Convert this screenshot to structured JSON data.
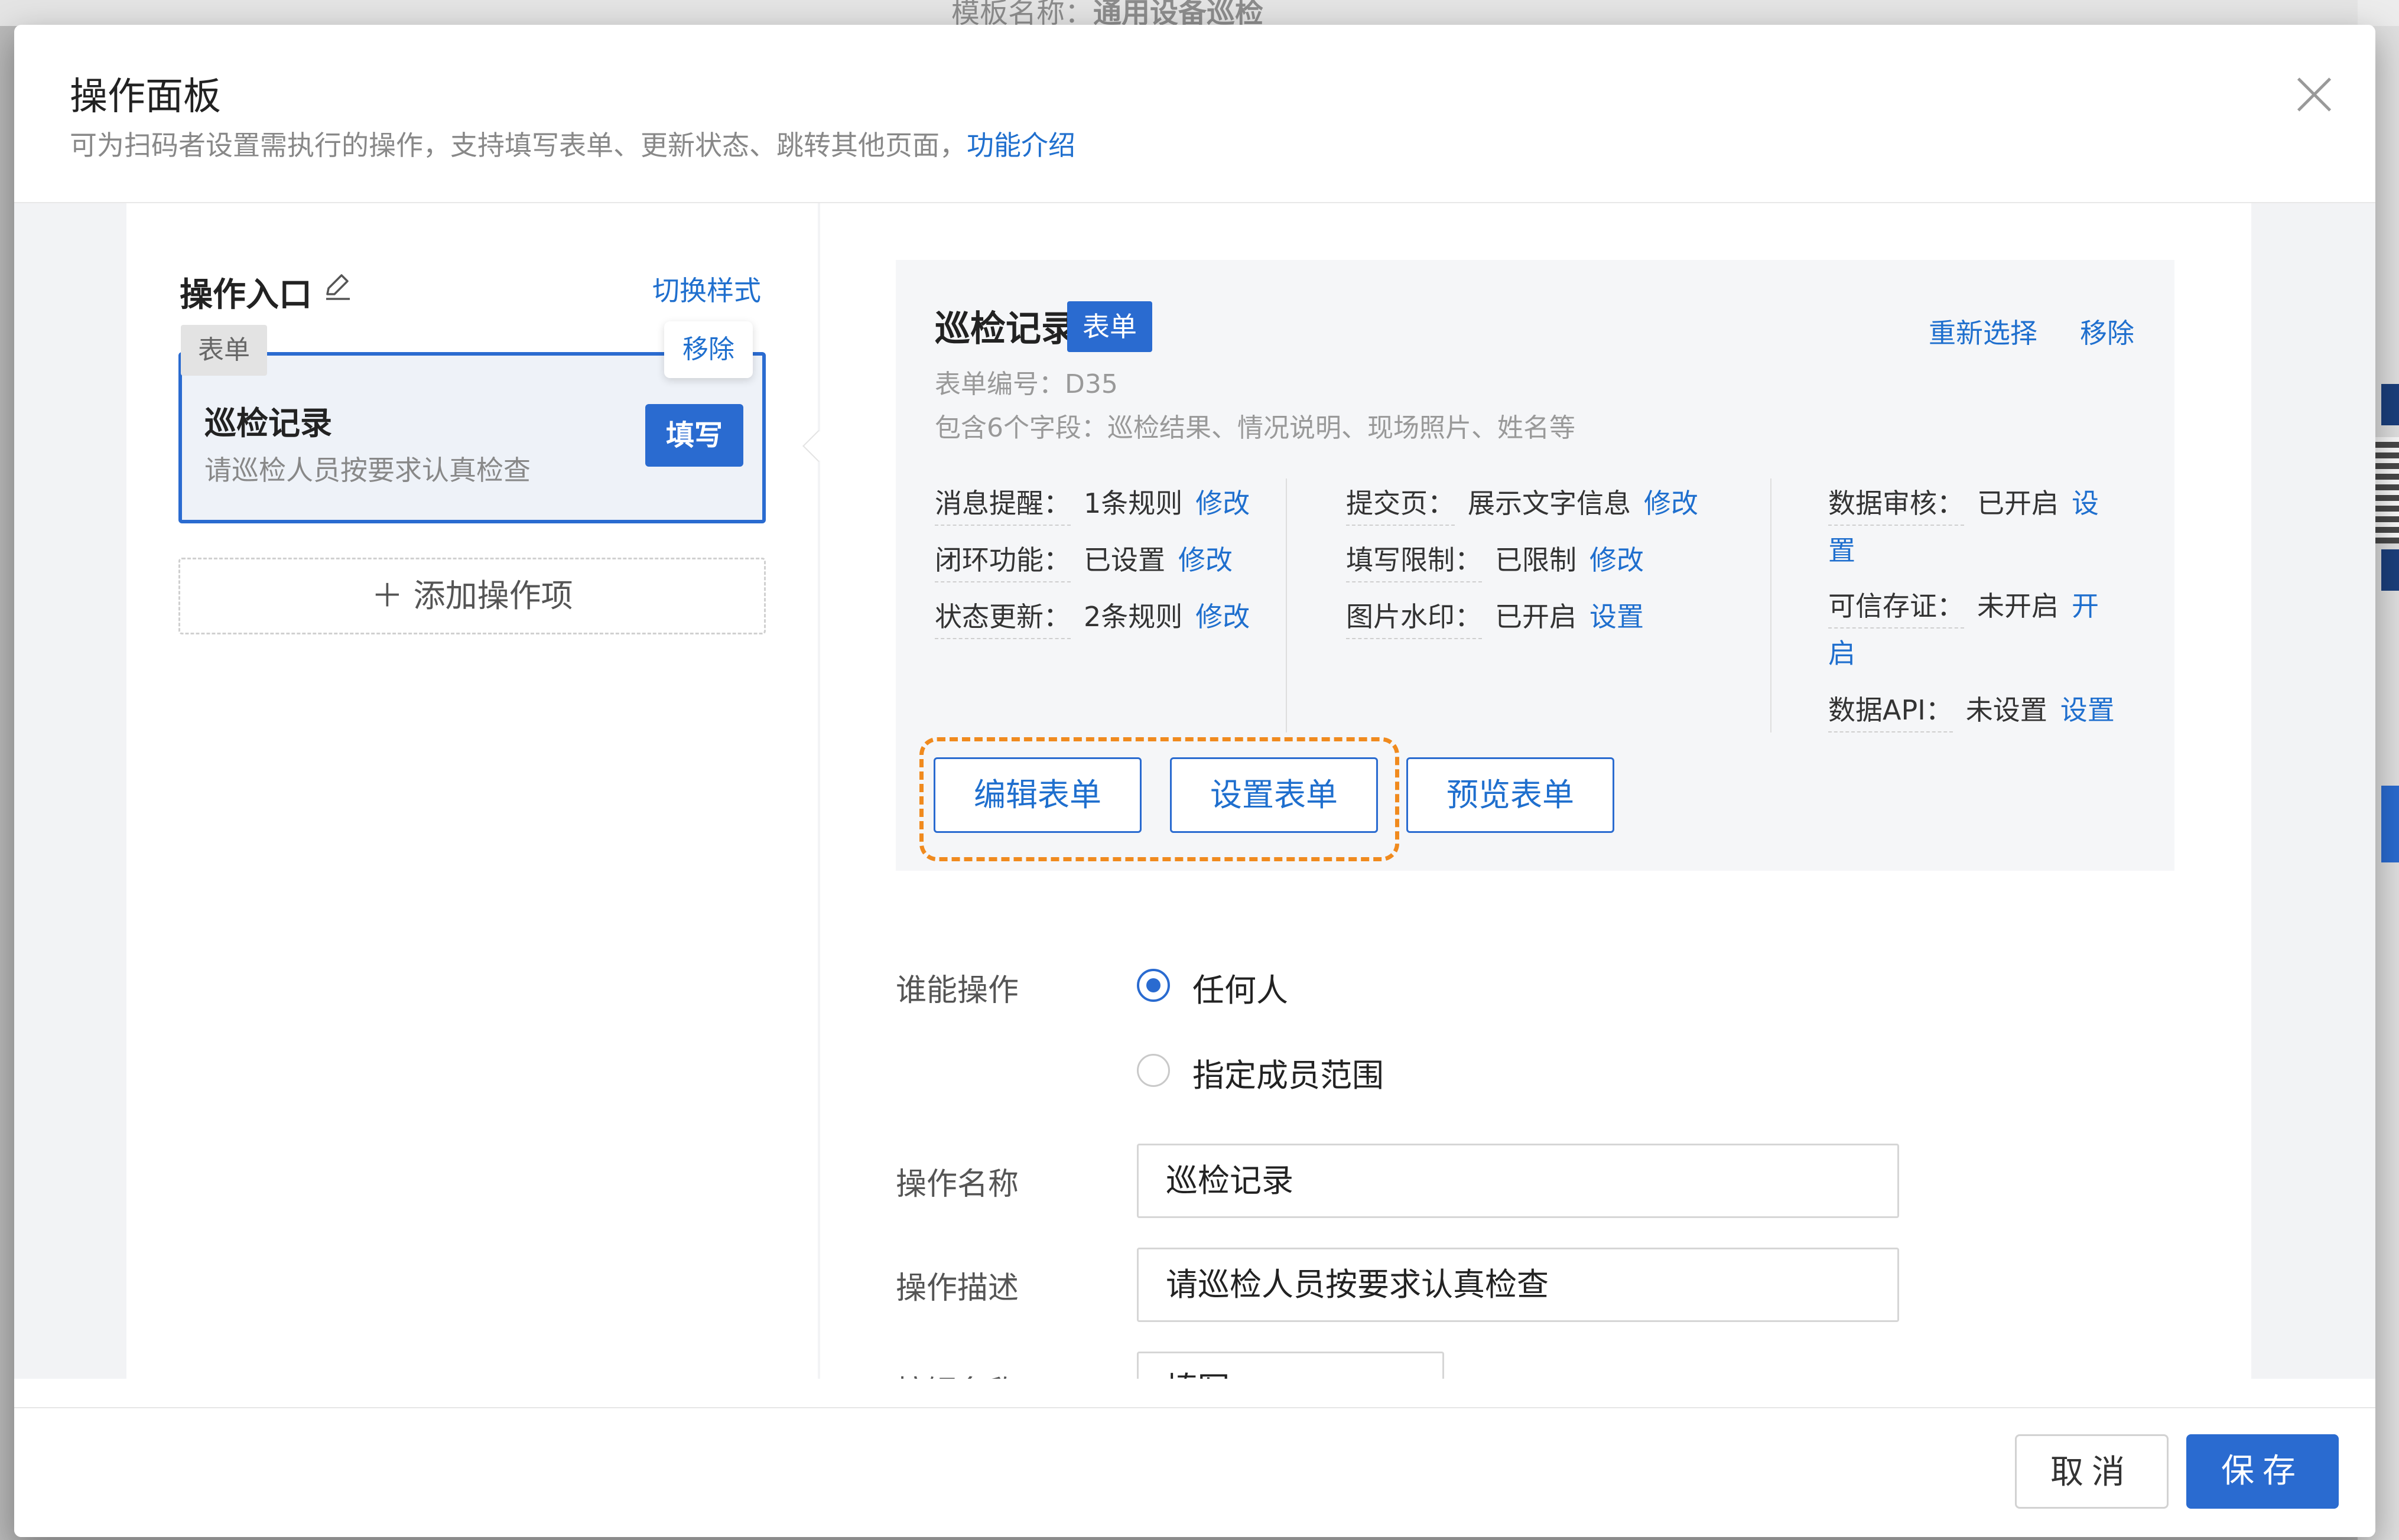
{
  "background": {
    "template_label": "模板名称：",
    "template_name": "通用设备巡检"
  },
  "modal": {
    "title": "操作面板",
    "subtitle": "可为扫码者设置需执行的操作，支持填写表单、更新状态、跳转其他页面，",
    "intro_link": "功能介绍",
    "close_icon": "close-icon"
  },
  "left": {
    "title": "操作入口",
    "edit_icon": "pencil-icon",
    "switch_style": "切换样式",
    "entry": {
      "tag": "表单",
      "remove": "移除",
      "name": "巡检记录",
      "desc": "请巡检人员按要求认真检查",
      "button": "填写"
    },
    "add_item": "＋ 添加操作项"
  },
  "form_card": {
    "name": "巡检记录",
    "badge": "表单",
    "reselect": "重新选择",
    "remove": "移除",
    "code": "表单编号：D35",
    "fields": "包含6个字段：巡检结果、情况说明、现场照片、姓名等",
    "settings": {
      "col1": [
        {
          "key": "消息提醒：",
          "value": "1条规则",
          "action": "修改"
        },
        {
          "key": "闭环功能：",
          "value": "已设置",
          "action": "修改"
        },
        {
          "key": "状态更新：",
          "value": "2条规则",
          "action": "修改"
        }
      ],
      "col2": [
        {
          "key": "提交页：",
          "value": "展示文字信息",
          "action": "修改"
        },
        {
          "key": "填写限制：",
          "value": "已限制",
          "action": "修改"
        },
        {
          "key": "图片水印：",
          "value": "已开启",
          "action": "设置"
        }
      ],
      "col3": [
        {
          "key": "数据审核：",
          "value": "已开启",
          "action_a": "设",
          "action_b": "置"
        },
        {
          "key": "可信存证：",
          "value": "未开启",
          "action_a": "开",
          "action_b": "启"
        },
        {
          "key": "数据API：",
          "value": "未设置",
          "action": "设置"
        }
      ]
    },
    "buttons": {
      "edit": "编辑表单",
      "settings": "设置表单",
      "preview": "预览表单"
    },
    "highlight_color": "#f08a1e"
  },
  "who": {
    "label": "谁能操作",
    "options": [
      {
        "label": "任何人",
        "selected": true
      },
      {
        "label": "指定成员范围",
        "selected": false
      }
    ]
  },
  "fields": {
    "name_label": "操作名称",
    "name_value": "巡检记录",
    "desc_label": "操作描述",
    "desc_value": "请巡检人员按要求认真检查",
    "button_label": "按钮名称",
    "button_value": "填写"
  },
  "footer": {
    "cancel": "取消",
    "save": "保存"
  },
  "colors": {
    "accent": "#2a6bd0",
    "link": "#1f6fce"
  }
}
